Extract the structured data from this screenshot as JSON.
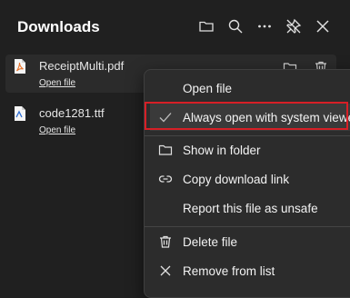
{
  "panel": {
    "title": "Downloads"
  },
  "toolbar": {
    "icons": [
      "folder-icon",
      "search-icon",
      "more-icon",
      "pin-icon",
      "close-icon"
    ]
  },
  "downloads": [
    {
      "name": "ReceiptMulti.pdf",
      "action": "Open file",
      "icon": "pdf-file-icon"
    },
    {
      "name": "code1281.ttf",
      "action": "Open file",
      "icon": "font-file-icon"
    }
  ],
  "context_menu": {
    "items": [
      {
        "label": "Open file",
        "icon": ""
      },
      {
        "label": "Always open with system viewer",
        "icon": "checkmark-icon",
        "checked": true
      },
      {
        "label": "Show in folder",
        "icon": "folder-icon"
      },
      {
        "label": "Copy download link",
        "icon": "link-icon"
      },
      {
        "label": "Report this file as unsafe",
        "icon": ""
      },
      {
        "label": "Delete file",
        "icon": "trash-icon"
      },
      {
        "label": "Remove from list",
        "icon": "close-icon"
      }
    ]
  },
  "colors": {
    "background": "#202020",
    "menu_background": "#2c2c2c",
    "highlight_border": "#d61f26",
    "pdf_icon": "#e8732b"
  }
}
